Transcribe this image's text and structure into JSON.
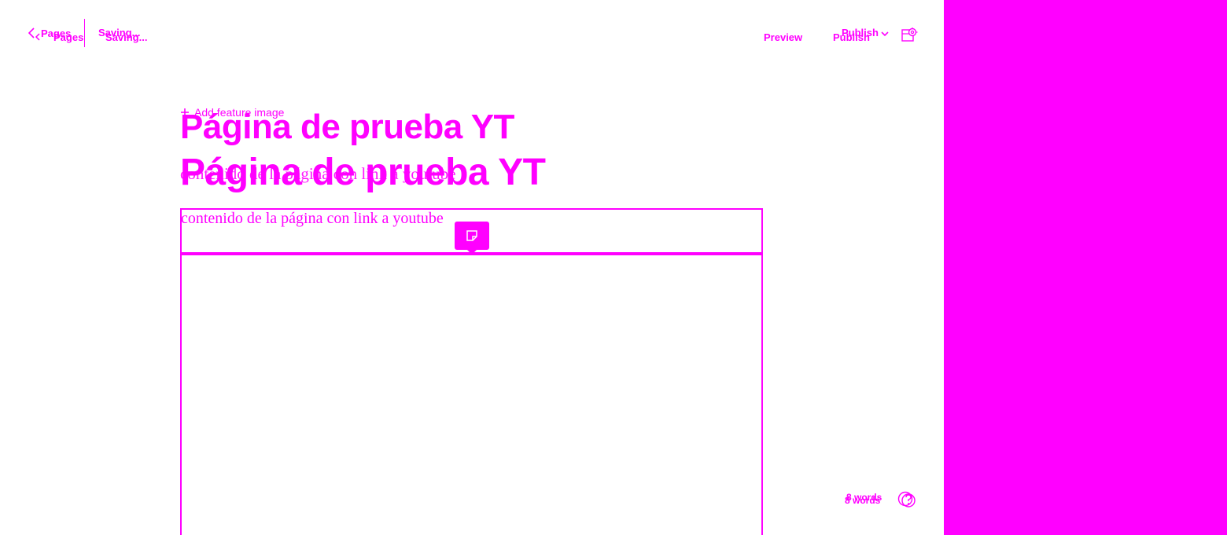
{
  "header": {
    "back_label": "Pages",
    "back_label_ghost": "Pages",
    "status": "Saving...",
    "status_ghost": "Saving...",
    "preview_label": "Preview",
    "publish_label": "Publish",
    "publish_label_ghost": "Publish"
  },
  "editor": {
    "add_feature_image": "Add feature image",
    "title": "Página de prueba YT",
    "title_ghost": "Página de prueba YT",
    "body_text": "contenido de la página con link a youtube",
    "body_text_ghost": "contenido de la página con link a youtube"
  },
  "footer": {
    "word_count": "8 words",
    "word_count_ghost": "8 words"
  },
  "icons": {
    "back": "chevron-left-icon",
    "publish_dropdown": "chevron-down-icon",
    "settings": "settings-panel-icon",
    "snippet": "snippet-icon",
    "help": "help-icon"
  },
  "colors": {
    "accent": "#ff00ff",
    "background": "#ffffff"
  }
}
